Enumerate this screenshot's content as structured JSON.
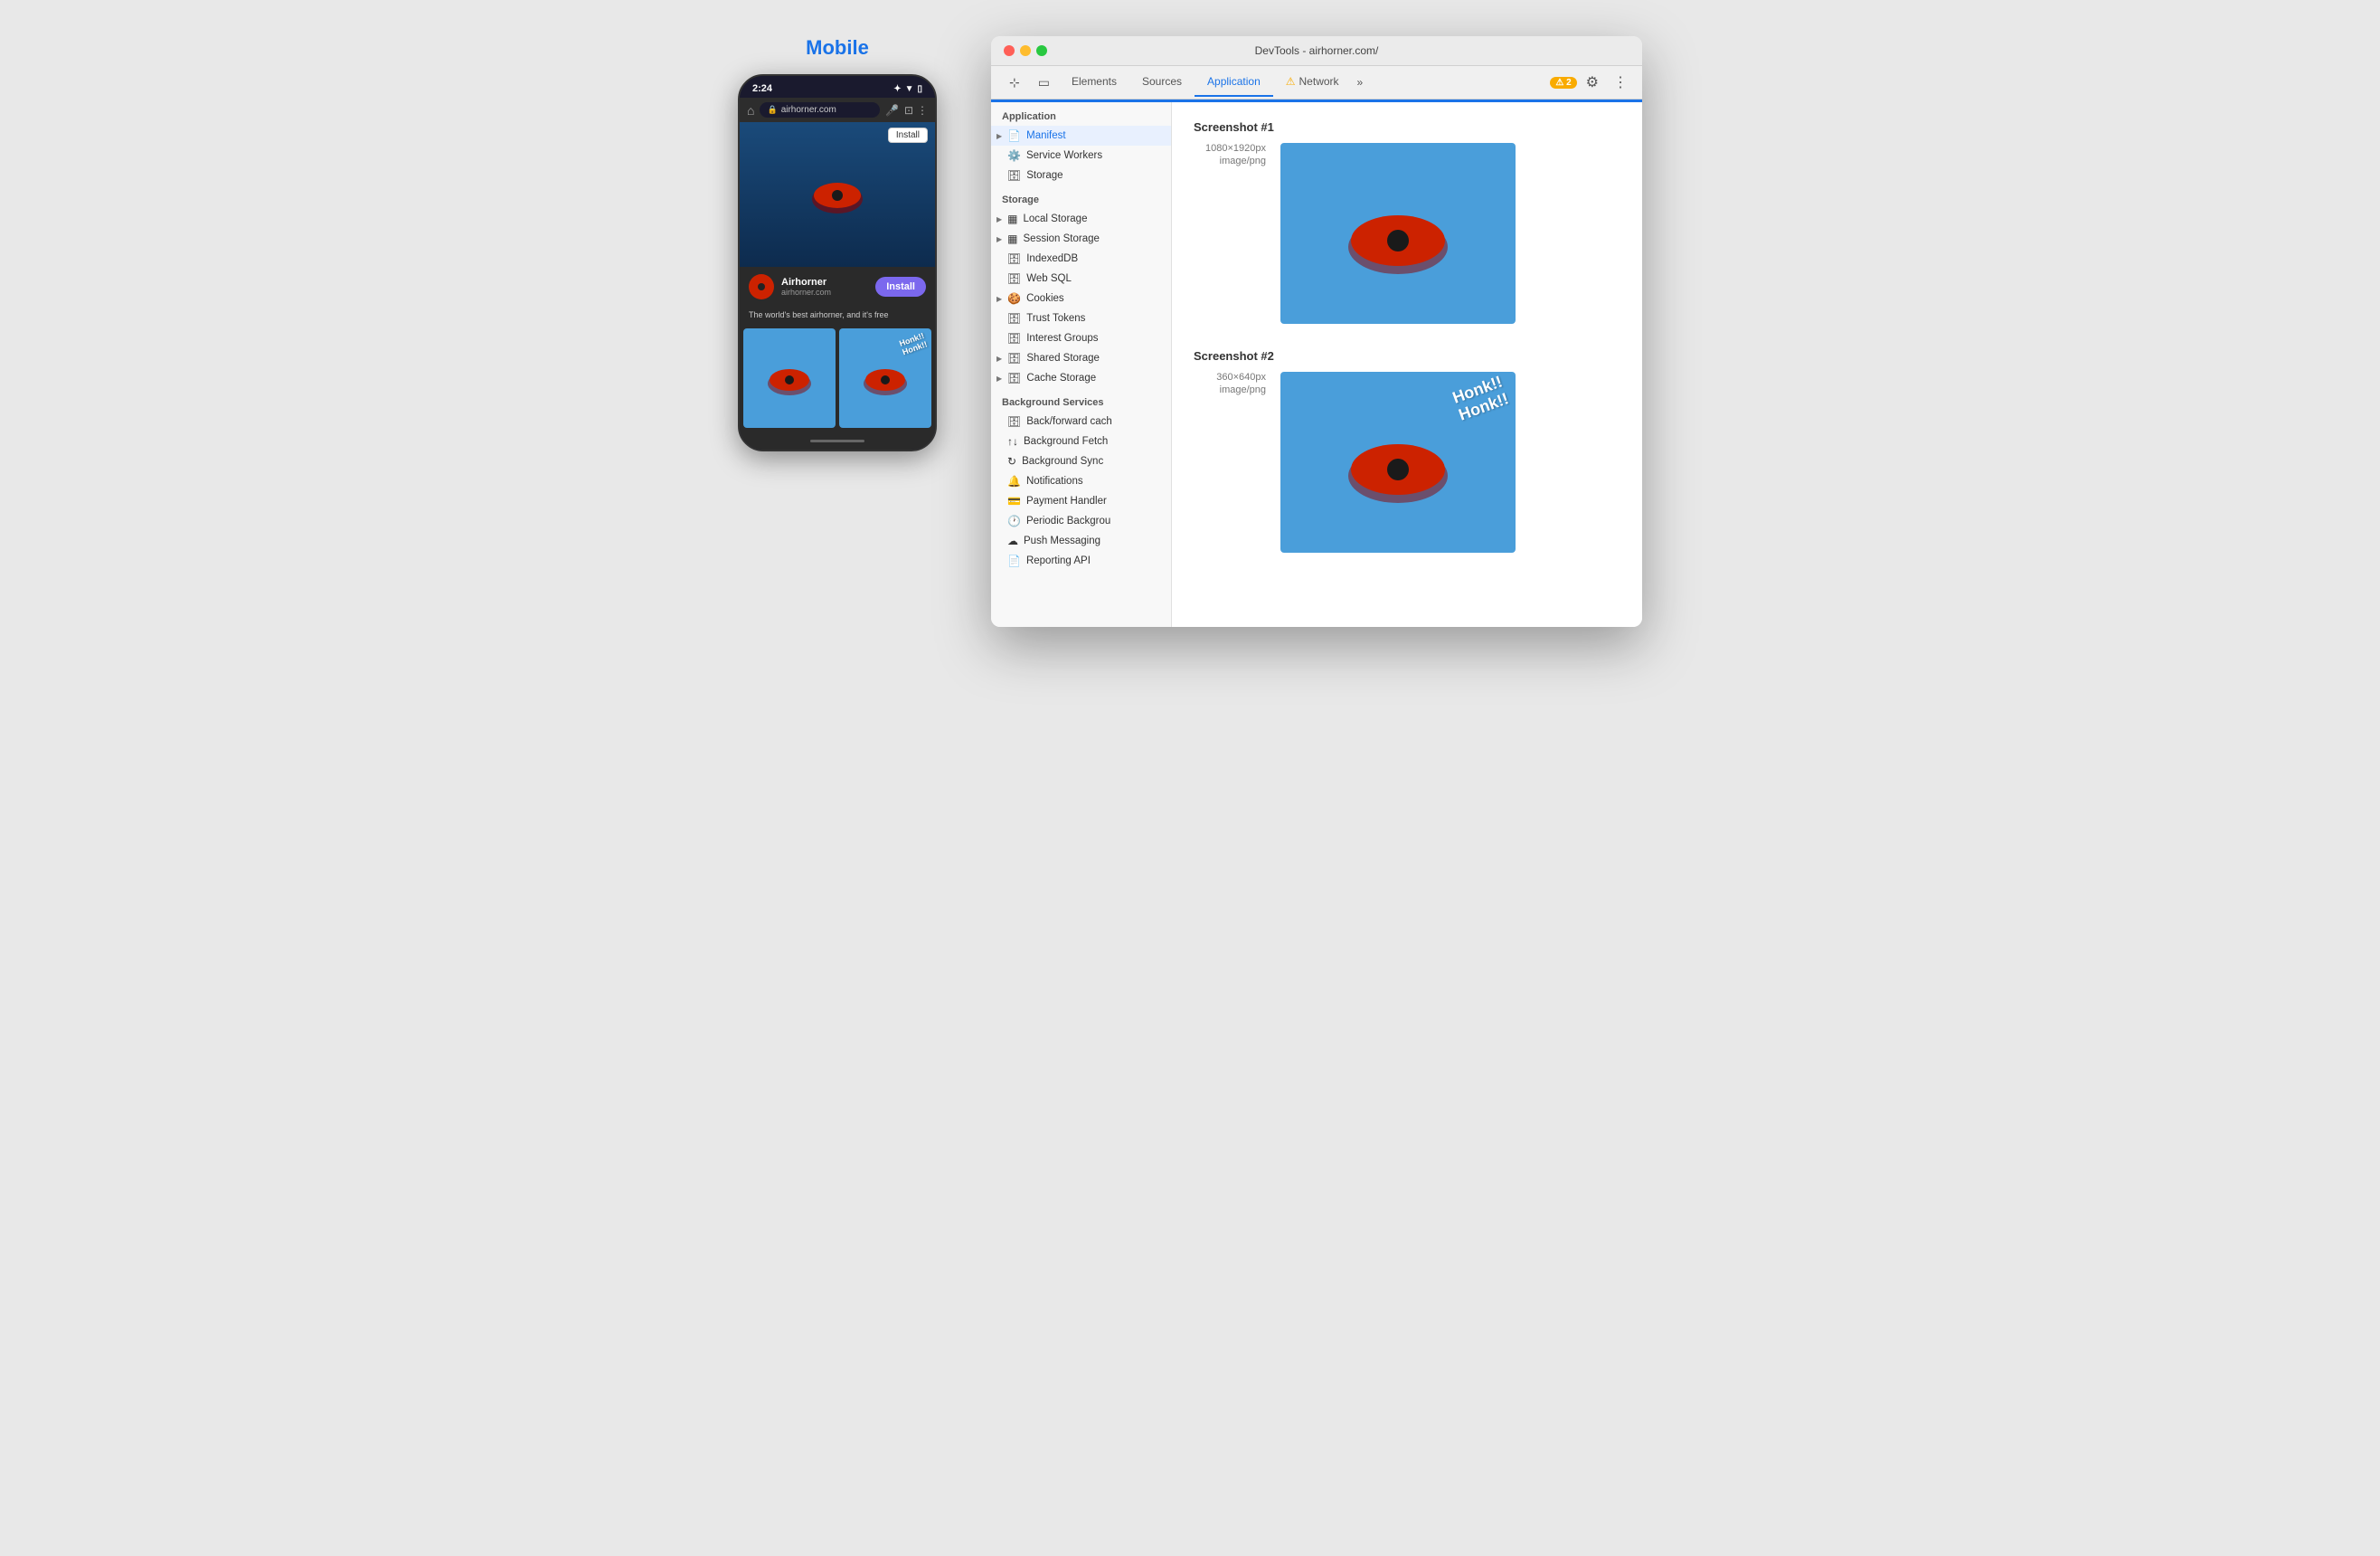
{
  "page": {
    "mobile_label": "Mobile",
    "phone": {
      "time": "2:24",
      "url": "airhorner.com",
      "install_top_btn": "Install",
      "app_name": "Airhorner",
      "app_url": "airhorner.com",
      "install_btn": "Install",
      "tagline": "The world's best airhorner, and it's free",
      "honk_text": "Honk!!\nHonk!!"
    },
    "devtools": {
      "title": "DevTools - airhorner.com/",
      "tabs": [
        "Elements",
        "Sources",
        "Application",
        "Network"
      ],
      "active_tab": "Application",
      "warning_badge": "▲ 2",
      "sidebar": {
        "application_section": "Application",
        "app_items": [
          {
            "label": "Manifest",
            "icon": "📄",
            "has_arrow": true
          },
          {
            "label": "Service Workers",
            "icon": "⚙️"
          },
          {
            "label": "Storage",
            "icon": "🗄️"
          }
        ],
        "storage_section": "Storage",
        "storage_items": [
          {
            "label": "Local Storage",
            "icon": "▦",
            "has_arrow": true
          },
          {
            "label": "Session Storage",
            "icon": "▦",
            "has_arrow": true
          },
          {
            "label": "IndexedDB",
            "icon": "🗄️"
          },
          {
            "label": "Web SQL",
            "icon": "🗄️"
          },
          {
            "label": "Cookies",
            "icon": "🍪",
            "has_arrow": true
          },
          {
            "label": "Trust Tokens",
            "icon": "🗄️"
          },
          {
            "label": "Interest Groups",
            "icon": "🗄️"
          },
          {
            "label": "Shared Storage",
            "icon": "🗄️",
            "has_arrow": true
          },
          {
            "label": "Cache Storage",
            "icon": "🗄️",
            "has_arrow": true
          }
        ],
        "bg_services_section": "Background Services",
        "bg_items": [
          {
            "label": "Back/forward cach",
            "icon": "🗄️"
          },
          {
            "label": "Background Fetch",
            "icon": "↑↓"
          },
          {
            "label": "Background Sync",
            "icon": "🔄"
          },
          {
            "label": "Notifications",
            "icon": "🔔"
          },
          {
            "label": "Payment Handler",
            "icon": "💳"
          },
          {
            "label": "Periodic Backgrou",
            "icon": "🕐"
          },
          {
            "label": "Push Messaging",
            "icon": "☁️"
          },
          {
            "label": "Reporting API",
            "icon": "📄"
          }
        ]
      },
      "main": {
        "screenshot1_title": "Screenshot #1",
        "screenshot1_dimensions": "1080×1920px",
        "screenshot1_mime": "image/png",
        "screenshot2_title": "Screenshot #2",
        "screenshot2_dimensions": "360×640px",
        "screenshot2_mime": "image/png"
      }
    }
  }
}
